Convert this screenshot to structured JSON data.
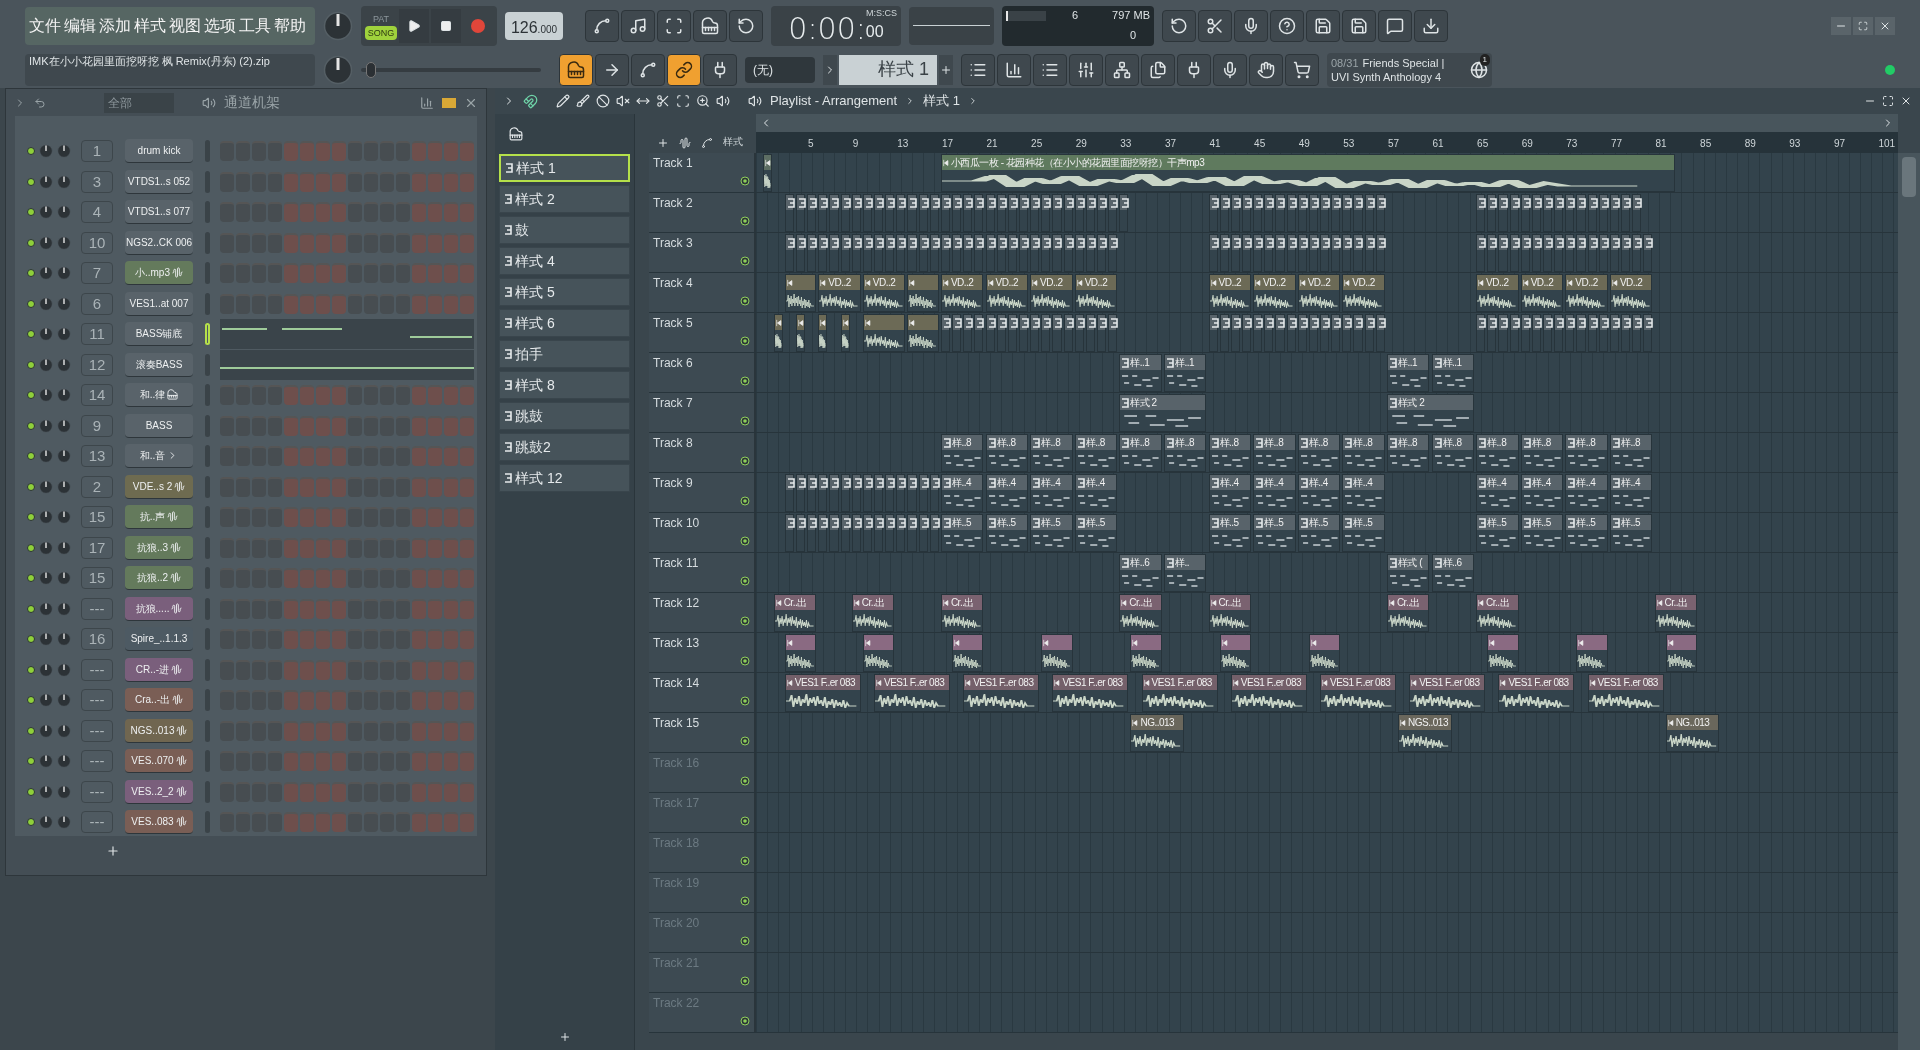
{
  "menu": [
    "文件",
    "编辑",
    "添加",
    "样式",
    "视图",
    "选项",
    "工具",
    "帮助"
  ],
  "transport": {
    "modes": [
      {
        "label": "PAT",
        "selected": false
      },
      {
        "label": "SONG",
        "selected": true
      }
    ],
    "tempo": "126",
    "tempo_fraction": ".000",
    "time": "0:00:",
    "time_small": "00",
    "time_unit": "M:S:CS"
  },
  "master_slider": {
    "level": 0.03
  },
  "hint": "IMK在小小花园里面挖呀挖 枫 Remix(丹东)  (2).zip",
  "monitor": {
    "cpu": "6",
    "memory": "797 MB",
    "polyphony": "0",
    "level": 0.04
  },
  "pattern_picker": {
    "none_label": "(无)",
    "pattern": "样式 1"
  },
  "news": {
    "date": "08/31",
    "line1": "Friends Special |",
    "line2": "UVI Synth Anthology 4",
    "badge": "1"
  },
  "channel_rack": {
    "filter": "全部",
    "title": "通道机架",
    "channels": [
      {
        "number": "1",
        "name": "drum kick",
        "color": "#59636a",
        "kind": "plain",
        "selected": false
      },
      {
        "number": "3",
        "name": "VTDS1..s 052",
        "color": "#59636a",
        "kind": "plain",
        "selected": false
      },
      {
        "number": "4",
        "name": "VTDS1..s 077",
        "color": "#59636a",
        "kind": "plain",
        "selected": false
      },
      {
        "number": "10",
        "name": "NGS2..CK 006",
        "color": "#59636a",
        "kind": "plain",
        "selected": false
      },
      {
        "number": "7",
        "name": "小..mp3",
        "color": "#647a5c",
        "kind": "audio",
        "selected": false
      },
      {
        "number": "6",
        "name": "VES1..at 007",
        "color": "#59636a",
        "kind": "plain",
        "selected": false
      },
      {
        "number": "11",
        "name": "BASS铺底",
        "color": "#59636a",
        "kind": "roll",
        "selected": true
      },
      {
        "number": "12",
        "name": "滚奏BASS",
        "color": "#59636a",
        "kind": "roll",
        "selected": false
      },
      {
        "number": "14",
        "name": "和..律",
        "color": "#59636a",
        "kind": "piano",
        "selected": false
      },
      {
        "number": "9",
        "name": "BASS",
        "color": "#59636a",
        "kind": "plain",
        "selected": false
      },
      {
        "number": "13",
        "name": "和..音",
        "color": "#59636a",
        "kind": "arrow",
        "selected": false
      },
      {
        "number": "2",
        "name": "VDE..s 2",
        "color": "#6e6b50",
        "kind": "audio",
        "selected": false
      },
      {
        "number": "15",
        "name": "抗..声",
        "color": "#647a5c",
        "kind": "audio",
        "selected": false
      },
      {
        "number": "17",
        "name": "抗狼..3",
        "color": "#647a5c",
        "kind": "audio",
        "selected": false
      },
      {
        "number": "15",
        "name": "抗狼..2",
        "color": "#647a5c",
        "kind": "audio",
        "selected": false
      },
      {
        "number": "---",
        "name": "抗狼.....",
        "color": "#7a5f7c",
        "kind": "audio",
        "selected": false
      },
      {
        "number": "16",
        "name": "Spire_..1.1.3",
        "color": "#4d5a63",
        "kind": "plain",
        "selected": false
      },
      {
        "number": "---",
        "name": "CR..-进",
        "color": "#7a5f7c",
        "kind": "audio",
        "selected": false
      },
      {
        "number": "---",
        "name": "Cra..-出",
        "color": "#7a5e55",
        "kind": "audio",
        "selected": false
      },
      {
        "number": "---",
        "name": "NGS..013",
        "color": "#706650",
        "kind": "audio",
        "selected": false
      },
      {
        "number": "---",
        "name": "VES..070",
        "color": "#7a5e55",
        "kind": "audio",
        "selected": false
      },
      {
        "number": "---",
        "name": "VES..2_2",
        "color": "#7a5f7c",
        "kind": "audio",
        "selected": false
      },
      {
        "number": "---",
        "name": "VES..083",
        "color": "#7a5e55",
        "kind": "audio",
        "selected": false
      }
    ]
  },
  "playlist": {
    "title": "Playlist - Arrangement",
    "pattern": "样式 1",
    "toolbar_label": "样式",
    "patterns": [
      {
        "name": "样式 1",
        "selected": true
      },
      {
        "name": "样式 2",
        "selected": false
      },
      {
        "name": "鼓",
        "selected": false
      },
      {
        "name": "样式 4",
        "selected": false
      },
      {
        "name": "样式 5",
        "selected": false
      },
      {
        "name": "样式 6",
        "selected": false
      },
      {
        "name": "拍手",
        "selected": false
      },
      {
        "name": "样式 8",
        "selected": false
      },
      {
        "name": "跳鼓",
        "selected": false
      },
      {
        "name": "跳鼓2",
        "selected": false
      },
      {
        "name": "样式 12",
        "selected": false
      }
    ],
    "ruler": [
      "5",
      "9",
      "13",
      "17",
      "21",
      "25",
      "29",
      "33",
      "37",
      "41",
      "45",
      "49",
      "53",
      "57",
      "61",
      "65",
      "69",
      "73",
      "77",
      "81",
      "85",
      "89",
      "93",
      "97",
      "101"
    ],
    "tracks": [
      {
        "name": "Track 1",
        "dimmed": false,
        "clips": [
          {
            "kind": "audio",
            "color": "#5d6e63"
          },
          {
            "kind": "audio",
            "label": "小西瓜一枚 - 花园种花（在小小的花园里面挖呀挖）干声mp3",
            "color": "#5f7a5e"
          }
        ]
      },
      {
        "name": "Track 2",
        "dimmed": false,
        "clips": [
          {
            "kind": "pattern",
            "color": "#58636a"
          },
          {
            "kind": "pattern",
            "color": "#58636a"
          },
          {
            "kind": "pattern",
            "color": "#58636a"
          }
        ]
      },
      {
        "name": "Track 3",
        "dimmed": false,
        "clips": [
          {
            "kind": "pattern",
            "color": "#58636a"
          },
          {
            "kind": "pattern",
            "color": "#58636a"
          },
          {
            "kind": "pattern",
            "color": "#58636a"
          }
        ]
      },
      {
        "name": "Track 4",
        "dimmed": false,
        "clips": [
          {
            "kind": "audio",
            "color": "#6c6a56"
          },
          {
            "kind": "audio",
            "label": "VD..2",
            "color": "#6c6a56"
          },
          {
            "kind": "audio",
            "label": "VD..2",
            "color": "#6c6a56"
          },
          {
            "kind": "audio",
            "color": "#6c6a56"
          },
          {
            "kind": "audio",
            "label": "VD..2",
            "color": "#6c6a56"
          },
          {
            "kind": "audio",
            "label": "VD..2",
            "color": "#6c6a56"
          },
          {
            "kind": "audio",
            "label": "VD..2",
            "color": "#6c6a56"
          },
          {
            "kind": "audio",
            "label": "VD..2",
            "color": "#6c6a56"
          },
          {
            "kind": "audio",
            "label": "VD..2",
            "color": "#6c6a56"
          },
          {
            "kind": "audio",
            "label": "VD..2",
            "color": "#6c6a56"
          },
          {
            "kind": "audio",
            "label": "VD..2",
            "color": "#6c6a56"
          },
          {
            "kind": "audio",
            "label": "VD..2",
            "color": "#6c6a56"
          },
          {
            "kind": "audio",
            "label": "VD..2",
            "color": "#6c6a56"
          },
          {
            "kind": "audio",
            "label": "VD..2",
            "color": "#6c6a56"
          },
          {
            "kind": "audio",
            "label": "VD..2",
            "color": "#6c6a56"
          },
          {
            "kind": "audio",
            "label": "VD..2",
            "color": "#6c6a56"
          }
        ]
      },
      {
        "name": "Track 5",
        "dimmed": false,
        "clips": [
          {
            "kind": "audio",
            "color": "#6c6a56"
          },
          {
            "kind": "audio",
            "color": "#6c6a56"
          },
          {
            "kind": "audio",
            "color": "#6c6a56"
          },
          {
            "kind": "audio",
            "color": "#6c6a56"
          },
          {
            "kind": "audio",
            "color": "#6c6a56"
          },
          {
            "kind": "audio",
            "color": "#6c6a56"
          },
          {
            "kind": "pattern",
            "color": "#58636a"
          },
          {
            "kind": "pattern",
            "color": "#58636a"
          },
          {
            "kind": "pattern",
            "color": "#58636a"
          }
        ]
      },
      {
        "name": "Track 6",
        "dimmed": false,
        "clips": [
          {
            "kind": "notes",
            "label": "样..1",
            "color": "#58636a"
          },
          {
            "kind": "notes",
            "label": "样..1",
            "color": "#58636a"
          },
          {
            "kind": "notes",
            "label": "样..1",
            "color": "#58636a"
          },
          {
            "kind": "notes",
            "label": "样..1",
            "color": "#58636a"
          }
        ]
      },
      {
        "name": "Track 7",
        "dimmed": false,
        "clips": [
          {
            "kind": "notes",
            "label": "样式 2",
            "color": "#58636a"
          },
          {
            "kind": "notes",
            "label": "样式 2",
            "color": "#58636a"
          }
        ]
      },
      {
        "name": "Track 8",
        "dimmed": false,
        "clips": [
          {
            "kind": "notes",
            "label": "样..8",
            "color": "#58636a"
          },
          {
            "kind": "notes",
            "label": "样..8",
            "color": "#58636a"
          },
          {
            "kind": "notes",
            "label": "样..8",
            "color": "#58636a"
          },
          {
            "kind": "notes",
            "label": "样..8",
            "color": "#58636a"
          },
          {
            "kind": "notes",
            "label": "样..8",
            "color": "#58636a"
          },
          {
            "kind": "notes",
            "label": "样..8",
            "color": "#58636a"
          },
          {
            "kind": "notes",
            "label": "样..8",
            "color": "#58636a"
          },
          {
            "kind": "notes",
            "label": "样..8",
            "color": "#58636a"
          },
          {
            "kind": "notes",
            "label": "样..8",
            "color": "#58636a"
          },
          {
            "kind": "notes",
            "label": "样..8",
            "color": "#58636a"
          },
          {
            "kind": "notes",
            "label": "样..8",
            "color": "#58636a"
          },
          {
            "kind": "notes",
            "label": "样..8",
            "color": "#58636a"
          },
          {
            "kind": "notes",
            "label": "样..8",
            "color": "#58636a"
          },
          {
            "kind": "notes",
            "label": "样..8",
            "color": "#58636a"
          },
          {
            "kind": "notes",
            "label": "样..8",
            "color": "#58636a"
          },
          {
            "kind": "notes",
            "label": "样..8",
            "color": "#58636a"
          }
        ]
      },
      {
        "name": "Track 9",
        "dimmed": false,
        "clips": [
          {
            "kind": "pattern",
            "color": "#58636a"
          },
          {
            "kind": "notes",
            "label": "样..4",
            "color": "#58636a"
          },
          {
            "kind": "notes",
            "label": "样..4",
            "color": "#58636a"
          },
          {
            "kind": "notes",
            "label": "样..4",
            "color": "#58636a"
          },
          {
            "kind": "notes",
            "label": "样..4",
            "color": "#58636a"
          },
          {
            "kind": "notes",
            "label": "样..4",
            "color": "#58636a"
          },
          {
            "kind": "notes",
            "label": "样..4",
            "color": "#58636a"
          },
          {
            "kind": "notes",
            "label": "样..4",
            "color": "#58636a"
          },
          {
            "kind": "notes",
            "label": "样..4",
            "color": "#58636a"
          },
          {
            "kind": "notes",
            "label": "样..4",
            "color": "#58636a"
          },
          {
            "kind": "notes",
            "label": "样..4",
            "color": "#58636a"
          },
          {
            "kind": "notes",
            "label": "样..4",
            "color": "#58636a"
          },
          {
            "kind": "notes",
            "label": "样..4",
            "color": "#58636a"
          }
        ]
      },
      {
        "name": "Track 10",
        "dimmed": false,
        "clips": [
          {
            "kind": "pattern",
            "color": "#58636a"
          },
          {
            "kind": "notes",
            "label": "样..5",
            "color": "#58636a"
          },
          {
            "kind": "notes",
            "label": "样..5",
            "color": "#58636a"
          },
          {
            "kind": "notes",
            "label": "样..5",
            "color": "#58636a"
          },
          {
            "kind": "notes",
            "label": "样..5",
            "color": "#58636a"
          },
          {
            "kind": "notes",
            "label": "样..5",
            "color": "#58636a"
          },
          {
            "kind": "notes",
            "label": "样..5",
            "color": "#58636a"
          },
          {
            "kind": "notes",
            "label": "样..5",
            "color": "#58636a"
          },
          {
            "kind": "notes",
            "label": "样..5",
            "color": "#58636a"
          },
          {
            "kind": "notes",
            "label": "样..5",
            "color": "#58636a"
          },
          {
            "kind": "notes",
            "label": "样..5",
            "color": "#58636a"
          },
          {
            "kind": "notes",
            "label": "样..5",
            "color": "#58636a"
          },
          {
            "kind": "notes",
            "label": "样..5",
            "color": "#58636a"
          }
        ]
      },
      {
        "name": "Track 11",
        "dimmed": false,
        "clips": [
          {
            "kind": "notes",
            "label": "样..6",
            "color": "#58636a"
          },
          {
            "kind": "notes",
            "label": "样..",
            "color": "#58636a"
          },
          {
            "kind": "notes",
            "label": "样式 (",
            "color": "#58636a"
          },
          {
            "kind": "notes",
            "label": "样..6",
            "color": "#58636a"
          }
        ]
      },
      {
        "name": "Track 12",
        "dimmed": false,
        "clips": [
          {
            "kind": "audio",
            "label": "Cr..出",
            "color": "#7a6270"
          },
          {
            "kind": "audio",
            "label": "Cr..出",
            "color": "#7a6270"
          },
          {
            "kind": "audio",
            "label": "Cr..出",
            "color": "#7a6270"
          },
          {
            "kind": "audio",
            "label": "Cr..出",
            "color": "#7a6270"
          },
          {
            "kind": "audio",
            "label": "Cr..出",
            "color": "#7a6270"
          },
          {
            "kind": "audio",
            "label": "Cr..出",
            "color": "#7a6270"
          },
          {
            "kind": "audio",
            "label": "Cr..出",
            "color": "#7a6270"
          },
          {
            "kind": "audio",
            "label": "Cr..出",
            "color": "#7a6270"
          }
        ]
      },
      {
        "name": "Track 13",
        "dimmed": false,
        "clips": [
          {
            "kind": "audio",
            "color": "#8a6a82"
          },
          {
            "kind": "audio",
            "color": "#8a6a82"
          },
          {
            "kind": "audio",
            "color": "#8a6a82"
          },
          {
            "kind": "audio",
            "color": "#8a6a82"
          },
          {
            "kind": "audio",
            "color": "#8a6a82"
          },
          {
            "kind": "audio",
            "color": "#8a6a82"
          },
          {
            "kind": "audio",
            "color": "#8a6a82"
          },
          {
            "kind": "audio",
            "color": "#8a6a82"
          },
          {
            "kind": "audio",
            "color": "#8a6a82"
          },
          {
            "kind": "audio",
            "color": "#8a6a82"
          }
        ]
      },
      {
        "name": "Track 14",
        "dimmed": false,
        "clips": [
          {
            "kind": "audio",
            "label": "VES1 F..er 083",
            "color": "#74606a"
          },
          {
            "kind": "audio",
            "label": "VES1 F..er 083",
            "color": "#74606a"
          },
          {
            "kind": "audio",
            "label": "VES1 F..er 083",
            "color": "#74606a"
          },
          {
            "kind": "audio",
            "label": "VES1 F..er 083",
            "color": "#74606a"
          },
          {
            "kind": "audio",
            "label": "VES1 F..er 083",
            "color": "#74606a"
          },
          {
            "kind": "audio",
            "label": "VES1 F..er 083",
            "color": "#74606a"
          },
          {
            "kind": "audio",
            "label": "VES1 F..er 083",
            "color": "#74606a"
          },
          {
            "kind": "audio",
            "label": "VES1 F..er 083",
            "color": "#74606a"
          },
          {
            "kind": "audio",
            "label": "VES1 F..er 083",
            "color": "#74606a"
          },
          {
            "kind": "audio",
            "label": "VES1 F..er 083",
            "color": "#74606a"
          }
        ]
      },
      {
        "name": "Track 15",
        "dimmed": false,
        "clips": [
          {
            "kind": "audio",
            "label": "NG..013",
            "color": "#6a675c"
          },
          {
            "kind": "audio",
            "label": "NGS..013",
            "color": "#6a675c"
          },
          {
            "kind": "audio",
            "label": "NG..013",
            "color": "#6a675c"
          }
        ]
      },
      {
        "name": "Track 16",
        "dimmed": true
      },
      {
        "name": "Track 17",
        "dimmed": true
      },
      {
        "name": "Track 18",
        "dimmed": true
      },
      {
        "name": "Track 19",
        "dimmed": true
      },
      {
        "name": "Track 20",
        "dimmed": true
      },
      {
        "name": "Track 21",
        "dimmed": true
      },
      {
        "name": "Track 22",
        "dimmed": true
      }
    ]
  }
}
